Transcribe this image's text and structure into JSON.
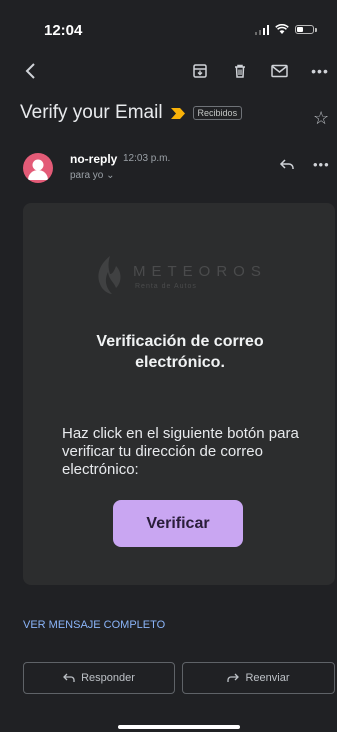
{
  "status_bar": {
    "time": "12:04"
  },
  "toolbar": {
    "back_icon": "back-arrow-icon",
    "archive_icon": "archive-icon",
    "delete_icon": "trash-icon",
    "mark_unread_icon": "mail-icon",
    "more_icon": "more-icon"
  },
  "email": {
    "subject": "Verify your Email",
    "label": "Recibidos",
    "sender_name": "no-reply",
    "time": "12:03 p.m.",
    "recipient": "para yo ⌄"
  },
  "content": {
    "brand_name": "METEOROS",
    "brand_tagline": "Renta de Autos",
    "heading": "Verificación de correo electrónico.",
    "body": "Haz click en el siguiente botón para verificar tu dirección de correo electrónico:",
    "button_label": "Verificar"
  },
  "footer": {
    "view_full": "VER MENSAJE COMPLETO",
    "reply_label": "Responder",
    "forward_label": "Reenviar"
  },
  "colors": {
    "background": "#202124",
    "card": "#2c2d2e",
    "button": "#c9a6f2",
    "link": "#8ab4f8",
    "importance": "#f9b208",
    "avatar": "#e35b77"
  }
}
